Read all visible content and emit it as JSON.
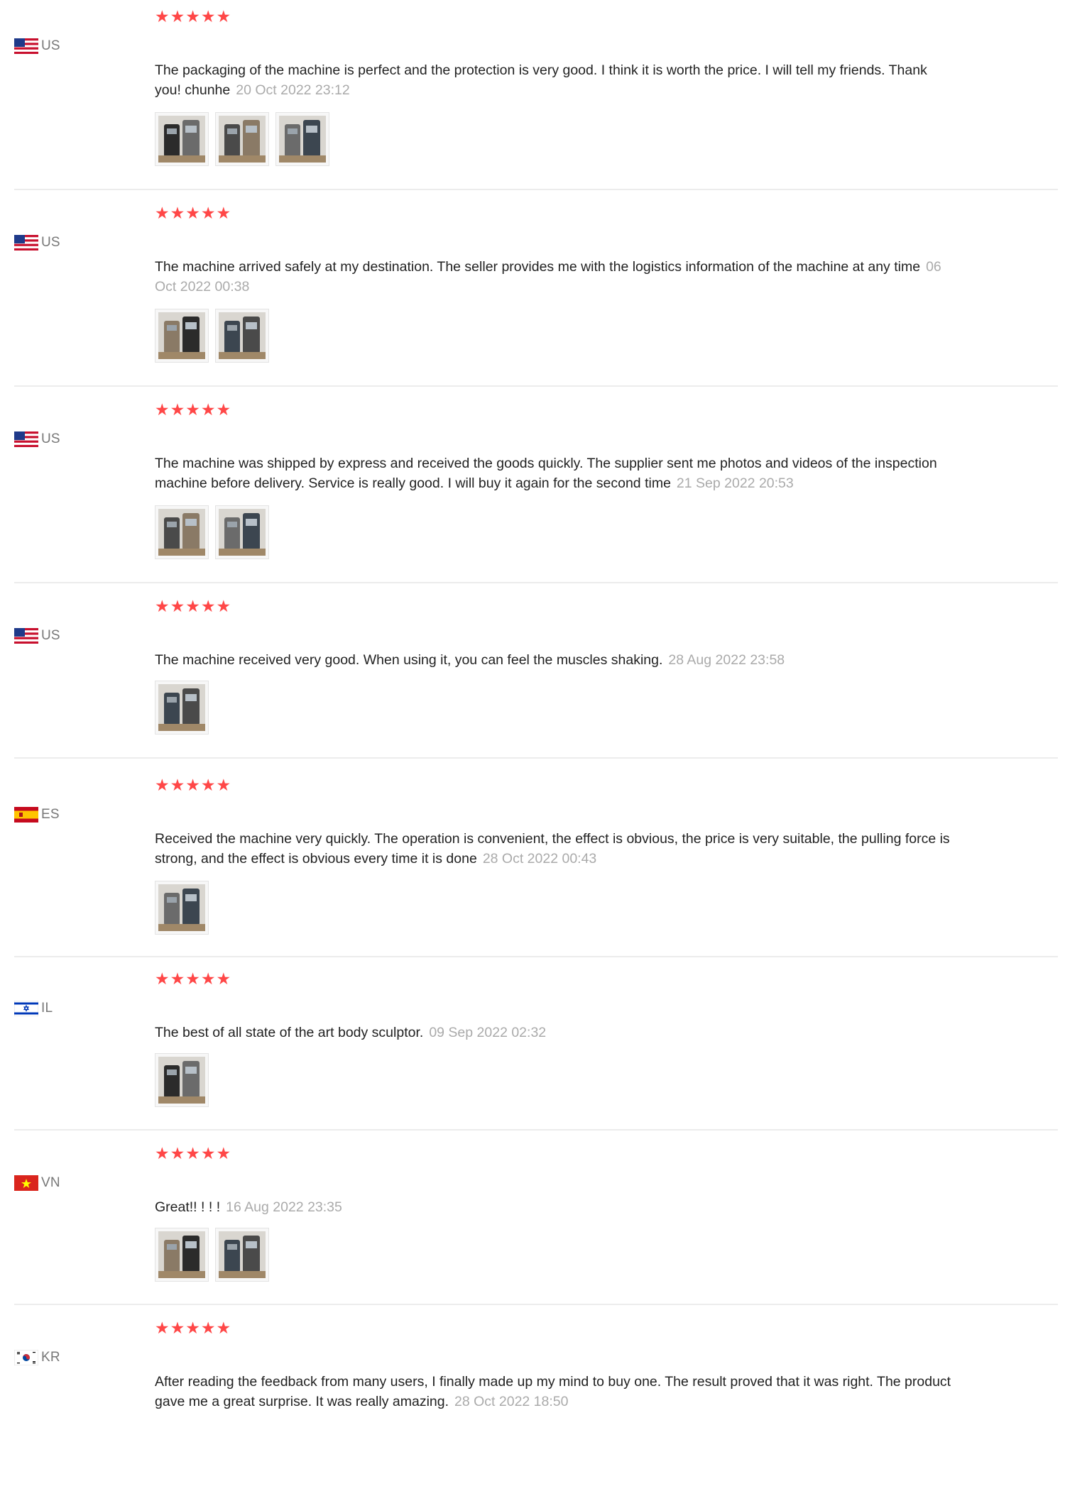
{
  "reviews": [
    {
      "country": "US",
      "flag": "us-flag-icon",
      "rating": 5,
      "text": "The packaging of the machine is perfect and the protection is very good. I think it is worth the price. I will tell my friends. Thank you! chunhe",
      "date": "20 Oct 2022 23:12",
      "photos": 3
    },
    {
      "country": "US",
      "flag": "us-flag-icon",
      "rating": 5,
      "text": "The machine arrived safely at my destination. The seller provides me with the logistics information of the machine at any time",
      "date": "06 Oct 2022 00:38",
      "photos": 2
    },
    {
      "country": "US",
      "flag": "us-flag-icon",
      "rating": 5,
      "text": "The machine was shipped by express and received the goods quickly. The supplier sent me photos and videos of the inspection machine before delivery. Service is really good. I will buy it again for the second time",
      "date": "21 Sep 2022 20:53",
      "photos": 2
    },
    {
      "country": "US",
      "flag": "us-flag-icon",
      "rating": 5,
      "text": "The machine received very good. When using it, you can feel the muscles shaking.",
      "date": "28 Aug 2022 23:58",
      "photos": 1
    },
    {
      "country": "ES",
      "flag": "es-flag-icon",
      "rating": 5,
      "text": "Received the machine very quickly. The operation is convenient, the effect is obvious, the price is very suitable, the pulling force is strong, and the effect is obvious every time it is done",
      "date": "28 Oct 2022 00:43",
      "photos": 1
    },
    {
      "country": "IL",
      "flag": "il-flag-icon",
      "rating": 5,
      "text": "The best of all state of the art body sculptor.",
      "date": "09 Sep 2022 02:32",
      "photos": 1
    },
    {
      "country": "VN",
      "flag": "vn-flag-icon",
      "rating": 5,
      "text": "Great!! ! ! !",
      "date": "16 Aug 2022 23:35",
      "photos": 2
    },
    {
      "country": "KR",
      "flag": "kr-flag-icon",
      "rating": 5,
      "text": "After reading the feedback from many users, I finally made up my mind to buy one. The result proved that it was right. The product gave me a great surprise. It was really amazing.",
      "date": "28 Oct 2022 18:50",
      "photos": 0
    }
  ],
  "colors": {
    "star": "#ff4747",
    "date": "#aaaaaa",
    "divider": "#ececec"
  }
}
